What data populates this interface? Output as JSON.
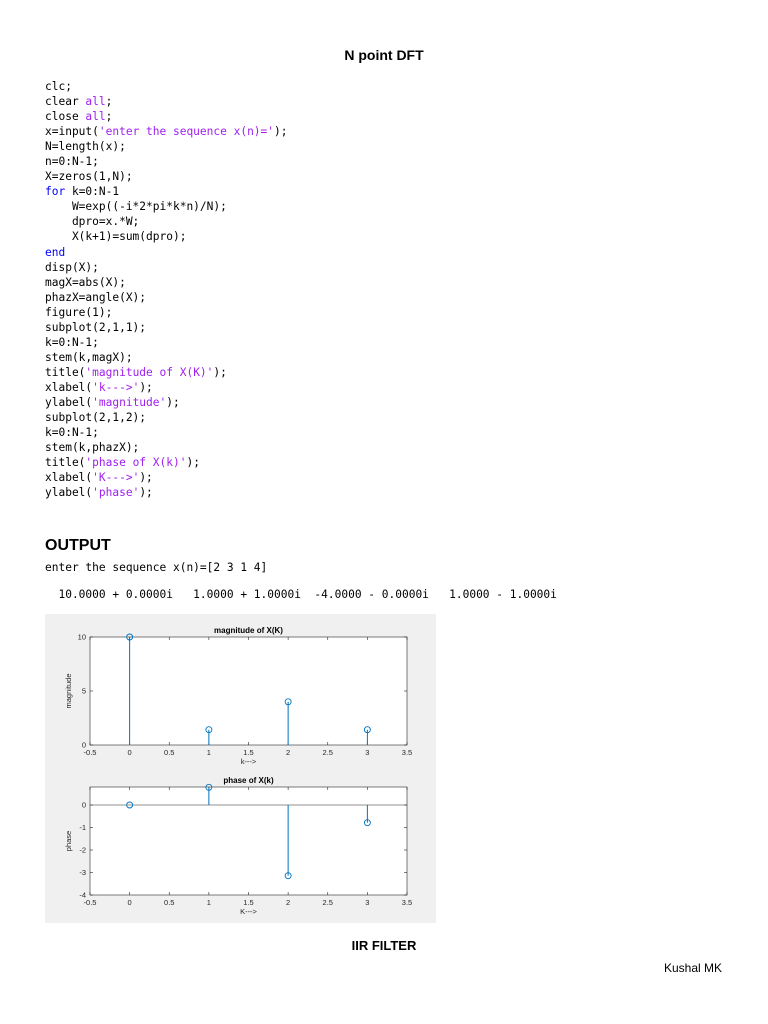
{
  "document": {
    "title": "N point DFT",
    "code_lines": [
      [
        {
          "t": "clc;",
          "c": "plain"
        }
      ],
      [
        {
          "t": "clear ",
          "c": "plain"
        },
        {
          "t": "all",
          "c": "str"
        },
        {
          "t": ";",
          "c": "plain"
        }
      ],
      [
        {
          "t": "close ",
          "c": "plain"
        },
        {
          "t": "all",
          "c": "str"
        },
        {
          "t": ";",
          "c": "plain"
        }
      ],
      [
        {
          "t": "x=input(",
          "c": "plain"
        },
        {
          "t": "'enter the sequence x(n)='",
          "c": "str"
        },
        {
          "t": ");",
          "c": "plain"
        }
      ],
      [
        {
          "t": "N=length(x);",
          "c": "plain"
        }
      ],
      [
        {
          "t": "n=0:N-1;",
          "c": "plain"
        }
      ],
      [
        {
          "t": "X=zeros(1,N);",
          "c": "plain"
        }
      ],
      [
        {
          "t": "for",
          "c": "kw"
        },
        {
          "t": " k=0:N-1",
          "c": "plain"
        }
      ],
      [
        {
          "t": "    W=exp((-i*2*pi*k*n)/N);",
          "c": "plain"
        }
      ],
      [
        {
          "t": "    dpro=x.*W;",
          "c": "plain"
        }
      ],
      [
        {
          "t": "    X(k+1)=sum(dpro);",
          "c": "plain"
        }
      ],
      [
        {
          "t": "end",
          "c": "kw"
        }
      ],
      [
        {
          "t": "disp(X);",
          "c": "plain"
        }
      ],
      [
        {
          "t": "magX=abs(X);",
          "c": "plain"
        }
      ],
      [
        {
          "t": "phazX=angle(X);",
          "c": "plain"
        }
      ],
      [
        {
          "t": "figure(1);",
          "c": "plain"
        }
      ],
      [
        {
          "t": "subplot(2,1,1);",
          "c": "plain"
        }
      ],
      [
        {
          "t": "k=0:N-1;",
          "c": "plain"
        }
      ],
      [
        {
          "t": "stem(k,magX);",
          "c": "plain"
        }
      ],
      [
        {
          "t": "title(",
          "c": "plain"
        },
        {
          "t": "'magnitude of X(K)'",
          "c": "str"
        },
        {
          "t": ");",
          "c": "plain"
        }
      ],
      [
        {
          "t": "xlabel(",
          "c": "plain"
        },
        {
          "t": "'k--->'",
          "c": "str"
        },
        {
          "t": ");",
          "c": "plain"
        }
      ],
      [
        {
          "t": "ylabel(",
          "c": "plain"
        },
        {
          "t": "'magnitude'",
          "c": "str"
        },
        {
          "t": ");",
          "c": "plain"
        }
      ],
      [
        {
          "t": "subplot(2,1,2);",
          "c": "plain"
        }
      ],
      [
        {
          "t": "k=0:N-1;",
          "c": "plain"
        }
      ],
      [
        {
          "t": "stem(k,phazX);",
          "c": "plain"
        }
      ],
      [
        {
          "t": "title(",
          "c": "plain"
        },
        {
          "t": "'phase of X(k)'",
          "c": "str"
        },
        {
          "t": ");",
          "c": "plain"
        }
      ],
      [
        {
          "t": "xlabel(",
          "c": "plain"
        },
        {
          "t": "'K--->'",
          "c": "str"
        },
        {
          "t": ");",
          "c": "plain"
        }
      ],
      [
        {
          "t": "ylabel(",
          "c": "plain"
        },
        {
          "t": "'phase'",
          "c": "str"
        },
        {
          "t": ");",
          "c": "plain"
        }
      ]
    ],
    "output_heading": "OUTPUT",
    "prompt_line": "enter the sequence x(n)=[2 3 1 4]",
    "result_line": "  10.0000 + 0.0000i   1.0000 + 1.0000i  -4.0000 - 0.0000i   1.0000 - 1.0000i",
    "next_section_title": "IIR FILTER",
    "author": "Kushal MK"
  },
  "colors": {
    "keyword": "#0000ff",
    "string": "#a020f0",
    "stem": "#0072bd",
    "figure_bg": "#f0f0f0"
  },
  "chart_data": [
    {
      "type": "stem",
      "title": "magnitude of X(K)",
      "xlabel": "k--->",
      "ylabel": "magnitude",
      "x": [
        0,
        1,
        2,
        3
      ],
      "y": [
        10,
        1.4142,
        4,
        1.4142
      ],
      "xlim": [
        -0.5,
        3.5
      ],
      "ylim": [
        0,
        10
      ],
      "xticks": [
        -0.5,
        0,
        0.5,
        1,
        1.5,
        2,
        2.5,
        3,
        3.5
      ],
      "xtick_labels": [
        "-0.5",
        "0",
        "0.5",
        "1",
        "1.5",
        "2",
        "2.5",
        "3",
        "3.5"
      ],
      "yticks": [
        0,
        5,
        10
      ],
      "ytick_labels": [
        "0",
        "5",
        "10"
      ],
      "grid": false
    },
    {
      "type": "stem",
      "title": "phase of X(k)",
      "xlabel": "K--->",
      "ylabel": "phase",
      "x": [
        0,
        1,
        2,
        3
      ],
      "y": [
        0,
        0.7854,
        -3.1416,
        -0.7854
      ],
      "xlim": [
        -0.5,
        3.5
      ],
      "ylim": [
        -4,
        0.8
      ],
      "xticks": [
        -0.5,
        0,
        0.5,
        1,
        1.5,
        2,
        2.5,
        3,
        3.5
      ],
      "xtick_labels": [
        "-0.5",
        "0",
        "0.5",
        "1",
        "1.5",
        "2",
        "2.5",
        "3",
        "3.5"
      ],
      "yticks": [
        -4,
        -3,
        -2,
        -1,
        0
      ],
      "ytick_labels": [
        "-4",
        "-3",
        "-2",
        "-1",
        "0"
      ],
      "grid": false
    }
  ]
}
